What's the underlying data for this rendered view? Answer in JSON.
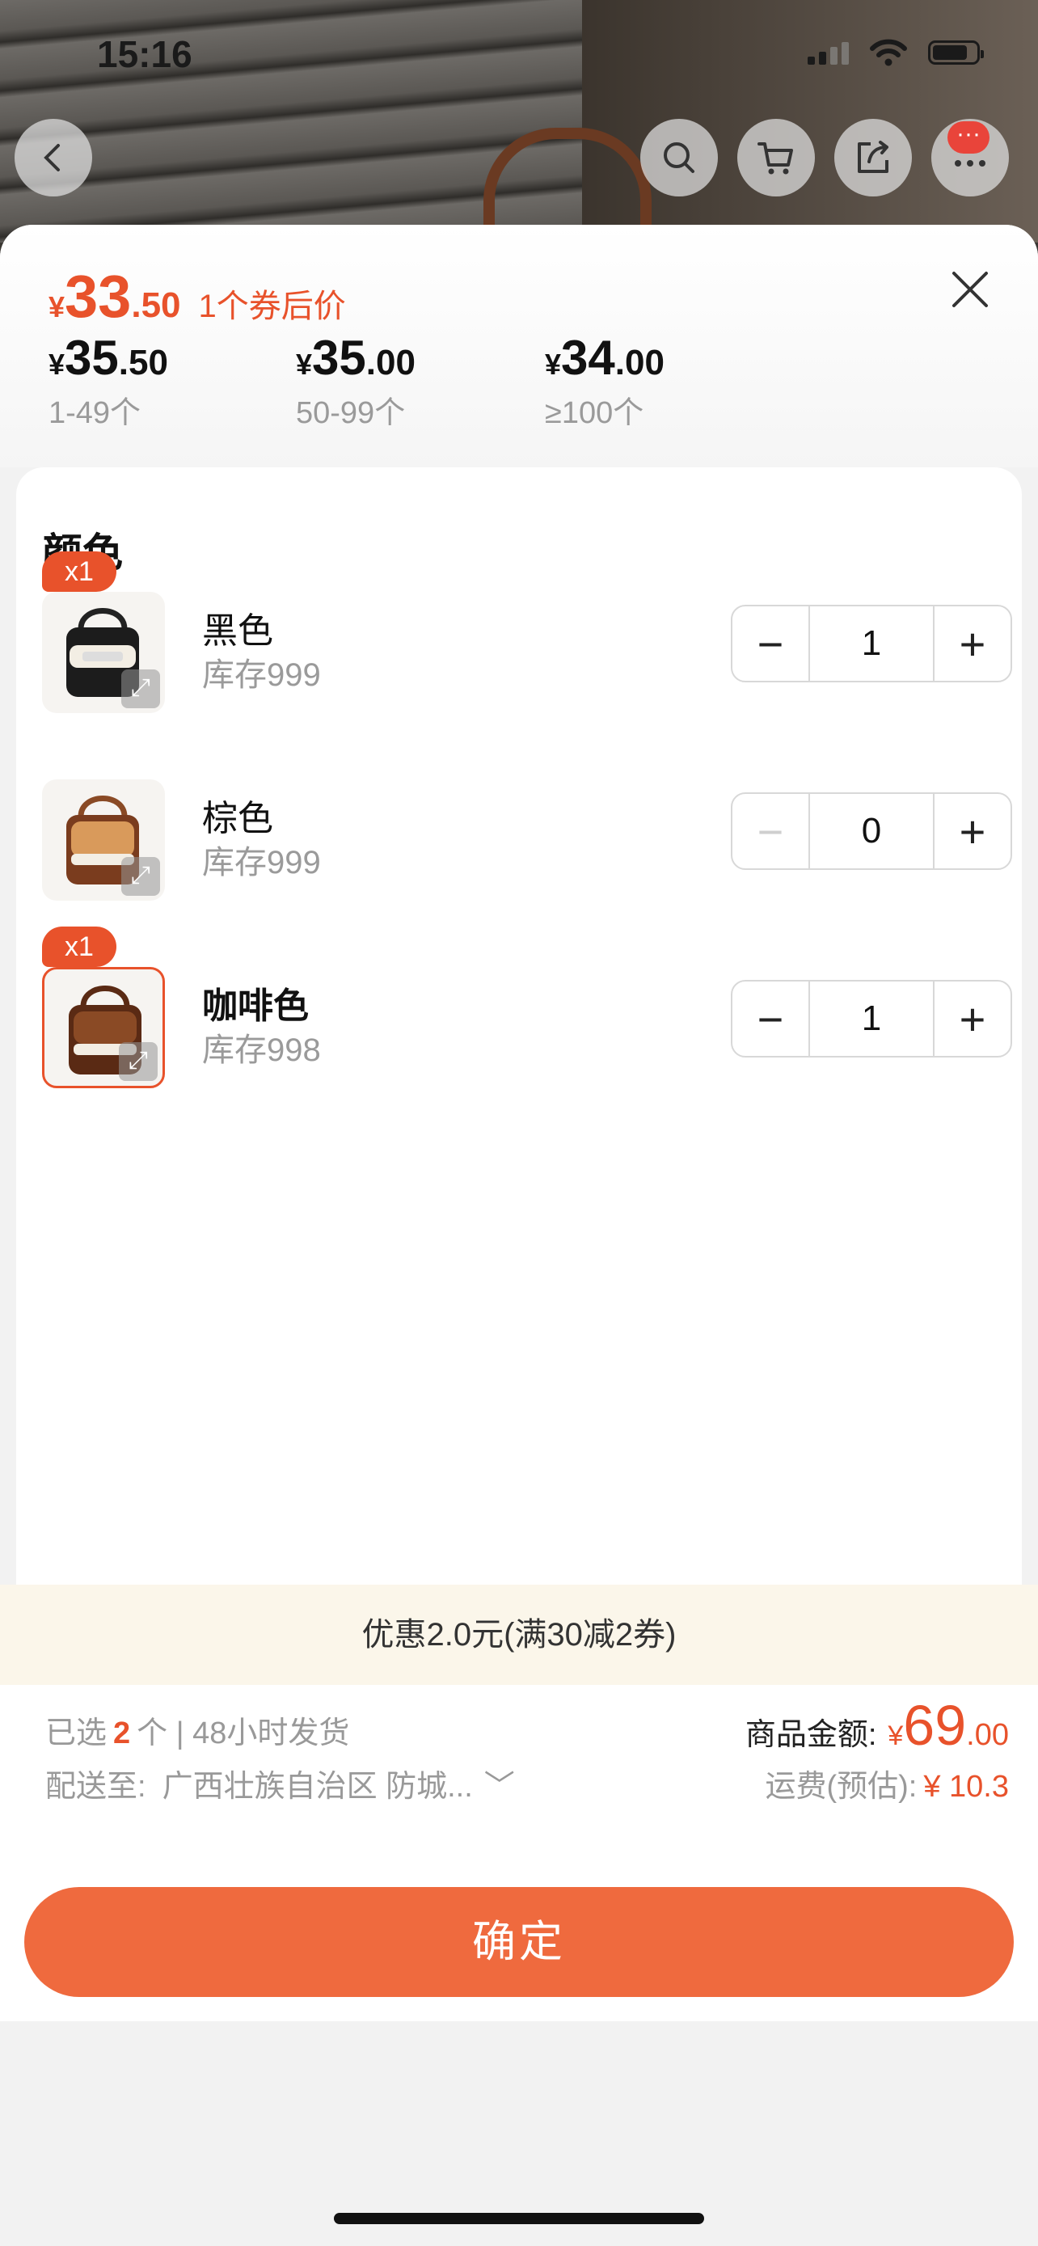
{
  "status_bar": {
    "time": "15:16"
  },
  "nav": {
    "back_icon": "chevron-left-icon",
    "search_icon": "search-icon",
    "cart_icon": "cart-icon",
    "share_icon": "share-icon",
    "more_icon": "more-icon",
    "message_badge": "···"
  },
  "price": {
    "currency": "¥",
    "integer": "33",
    "decimal": ".50",
    "coupon_label": "1个券后价"
  },
  "tiers": [
    {
      "currency": "¥",
      "integer": "35",
      "decimal": ".50",
      "range": "1-49个"
    },
    {
      "currency": "¥",
      "integer": "35",
      "decimal": ".00",
      "range": "50-99个"
    },
    {
      "currency": "¥",
      "integer": "34",
      "decimal": ".00",
      "range": "≥100个"
    }
  ],
  "section_title": "颜色",
  "items": [
    {
      "badge": "x1",
      "name": "黑色",
      "stock": "库存999",
      "quantity": "1",
      "minus": "−",
      "plus": "+"
    },
    {
      "badge": "",
      "name": "棕色",
      "stock": "库存999",
      "quantity": "0",
      "minus": "−",
      "plus": "+"
    },
    {
      "badge": "x1",
      "name": "咖啡色",
      "stock": "库存998",
      "quantity": "1",
      "minus": "−",
      "plus": "+"
    }
  ],
  "promo": "优惠2.0元(满30减2券)",
  "footer": {
    "selected_prefix": "已选",
    "selected_count": "2",
    "selected_suffix": "个 | 48小时发货",
    "ship_label": "配送至:",
    "ship_address": "广西壮族自治区 防城...",
    "amount_label": "商品金额:",
    "amount_currency": "¥",
    "amount_integer": "69",
    "amount_decimal": ".00",
    "fee_label": "运费(预估):",
    "fee_value": "¥ 10.3",
    "confirm_label": "确定"
  },
  "colors": {
    "accent": "#e8522b",
    "button": "#ef6a3e",
    "promo_bg": "#fbf6ea"
  }
}
